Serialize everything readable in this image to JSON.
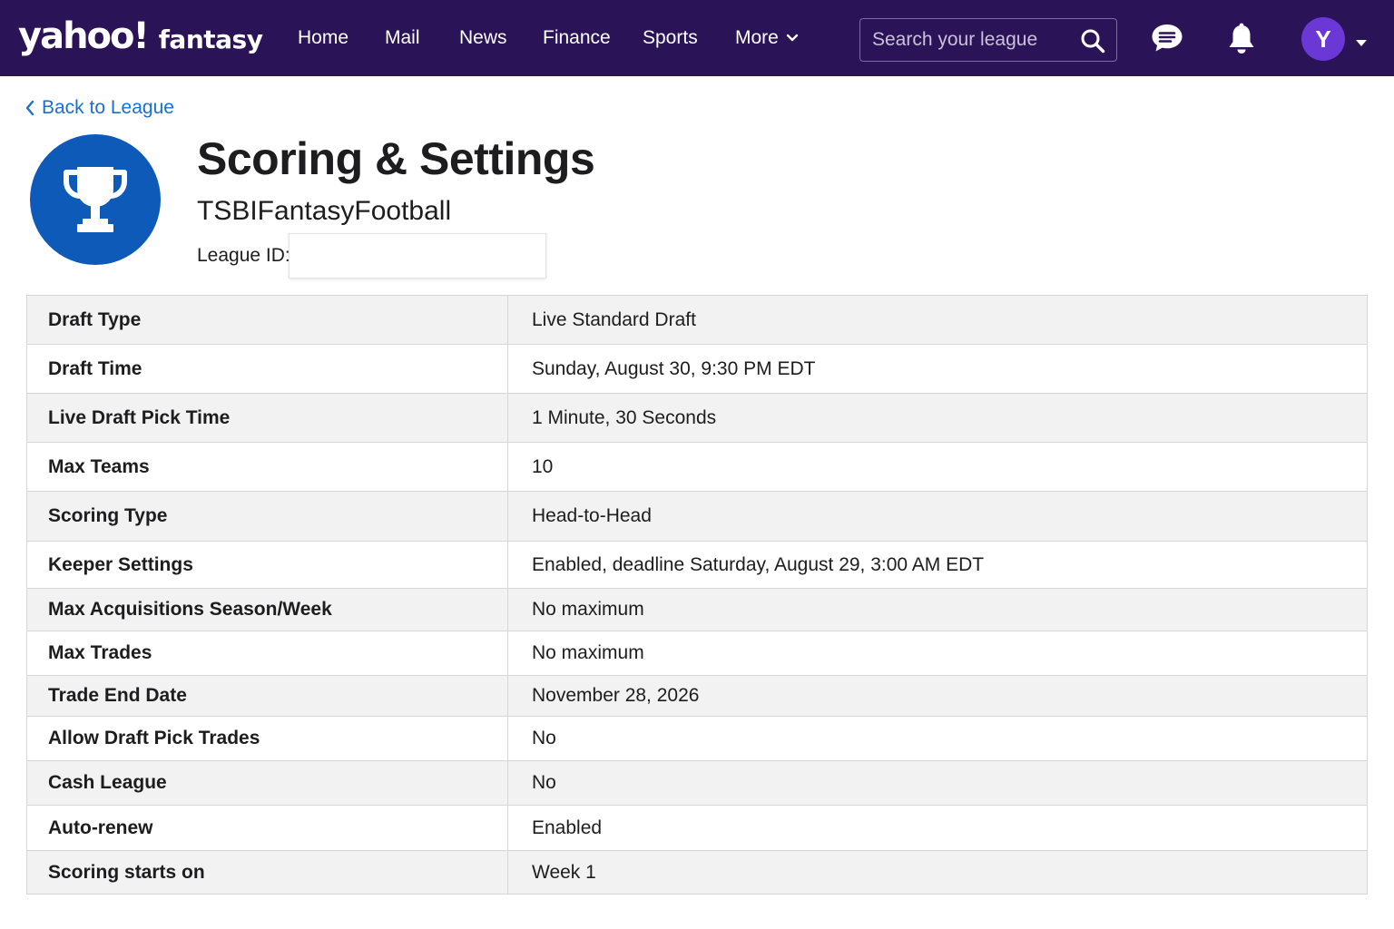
{
  "brand": {
    "logo_main": "yahoo!",
    "logo_sub": "fantasy"
  },
  "nav": {
    "items": [
      {
        "label": "Home"
      },
      {
        "label": "Mail"
      },
      {
        "label": "News"
      },
      {
        "label": "Finance"
      },
      {
        "label": "Sports"
      },
      {
        "label": "More"
      }
    ]
  },
  "search": {
    "placeholder": "Search your league",
    "value": ""
  },
  "user": {
    "avatar_initial": "Y"
  },
  "icons": {
    "search": "search-icon",
    "chat": "chat-icon",
    "notifications": "bell-icon",
    "back": "chevron-left-icon",
    "more_caret": "chevron-down-icon",
    "avatar_caret": "caret-down-icon",
    "league": "trophy-icon"
  },
  "colors": {
    "topbar": "#2b1358",
    "avatar": "#6b38d6",
    "link": "#1a6fd1",
    "trophy_badge": "#0d5ab8",
    "row_alt": "#f2f2f2"
  },
  "header": {
    "back_label": "Back to League",
    "title": "Scoring & Settings",
    "league_name": "TSBIFantasyFootball",
    "league_id_label": "League ID:",
    "league_id_value": ""
  },
  "settings": [
    {
      "label": "Draft Type",
      "value": "Live Standard Draft"
    },
    {
      "label": "Draft Time",
      "value": "Sunday, August 30, 9:30 PM EDT"
    },
    {
      "label": "Live Draft Pick Time",
      "value": "1 Minute, 30 Seconds"
    },
    {
      "label": "Max Teams",
      "value": "10"
    },
    {
      "label": "Scoring Type",
      "value": "Head-to-Head"
    },
    {
      "label": "Keeper Settings",
      "value": "Enabled, deadline Saturday, August 29, 3:00 AM EDT"
    },
    {
      "label": "Max Acquisitions Season/Week",
      "value": "No maximum"
    },
    {
      "label": "Max Trades",
      "value": "No maximum"
    },
    {
      "label": "Trade End Date",
      "value": "November 28, 2026"
    },
    {
      "label": "Allow Draft Pick Trades",
      "value": "No"
    },
    {
      "label": "Cash League",
      "value": "No"
    },
    {
      "label": "Auto-renew",
      "value": "Enabled"
    },
    {
      "label": "Scoring starts on",
      "value": "Week 1"
    }
  ]
}
